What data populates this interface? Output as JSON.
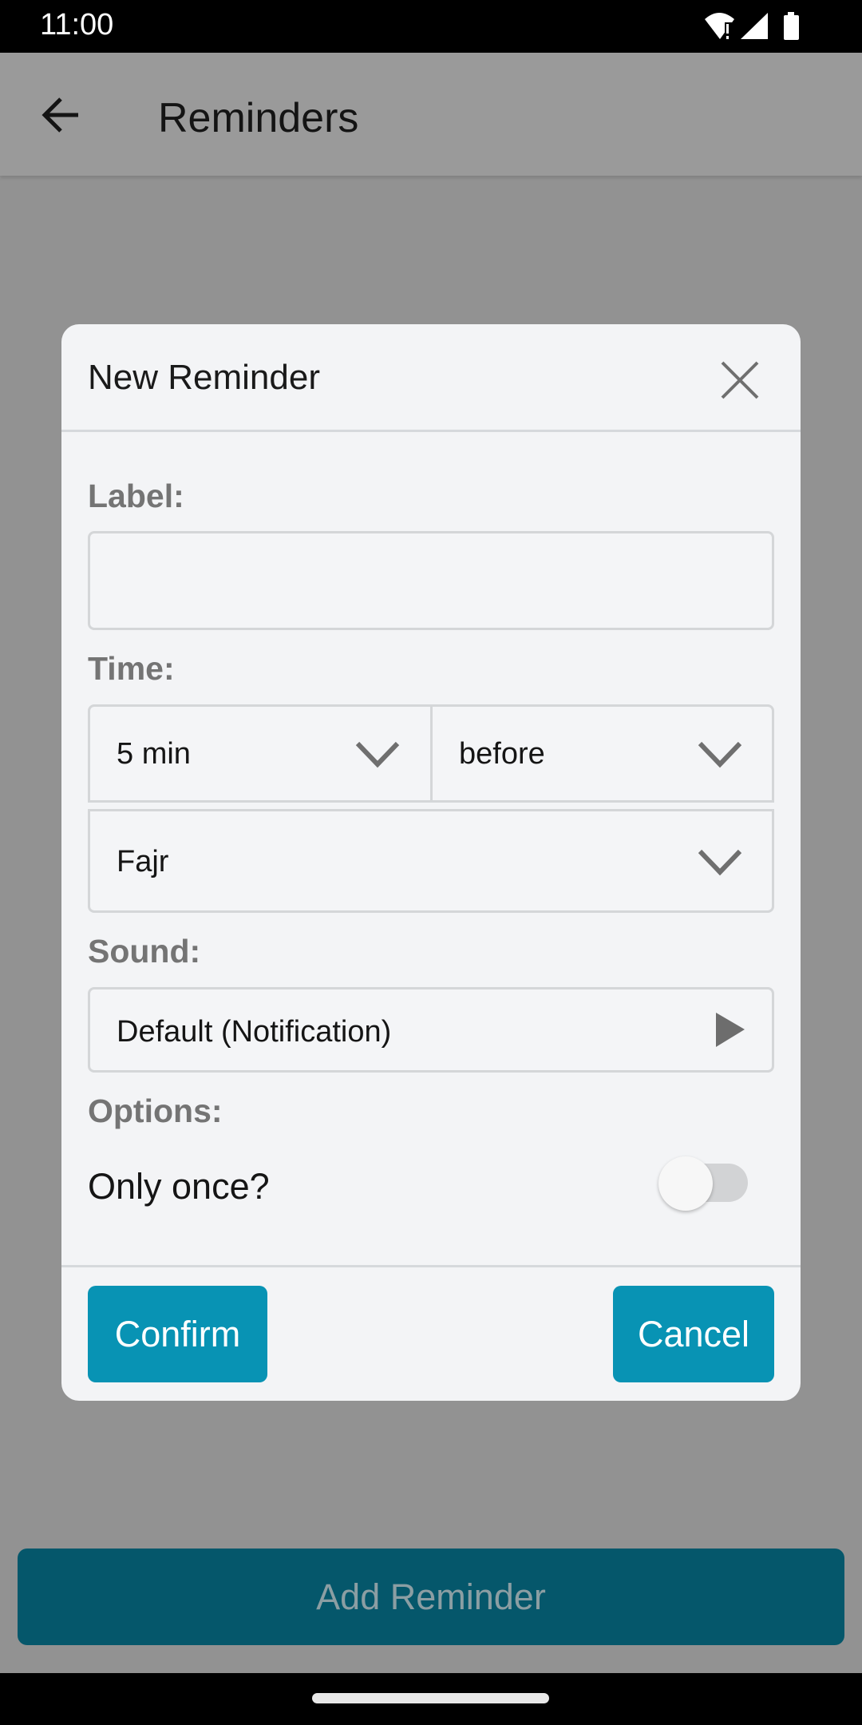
{
  "status_bar": {
    "time": "11:00",
    "icons": [
      "wifi-alert-icon",
      "signal-icon",
      "battery-icon"
    ]
  },
  "app_bar": {
    "back_icon": "arrow-left-icon",
    "title": "Reminders"
  },
  "dialog": {
    "title": "New Reminder",
    "close_icon": "close-icon",
    "label_field": {
      "label": "Label:",
      "value": "",
      "placeholder": ""
    },
    "time": {
      "label": "Time:",
      "offset_value": "5 min",
      "direction_value": "before",
      "prayer_value": "Fajr"
    },
    "sound": {
      "label": "Sound:",
      "value": "Default (Notification)",
      "play_icon": "play-icon"
    },
    "options": {
      "label": "Options:",
      "only_once_label": "Only once?",
      "only_once_enabled": false
    },
    "confirm_label": "Confirm",
    "cancel_label": "Cancel"
  },
  "add_reminder_label": "Add Reminder",
  "colors": {
    "accent": "#0893b4",
    "accent_dimmed": "#05576b",
    "dialog_bg": "#f3f4f6",
    "scrim": "#929292"
  }
}
